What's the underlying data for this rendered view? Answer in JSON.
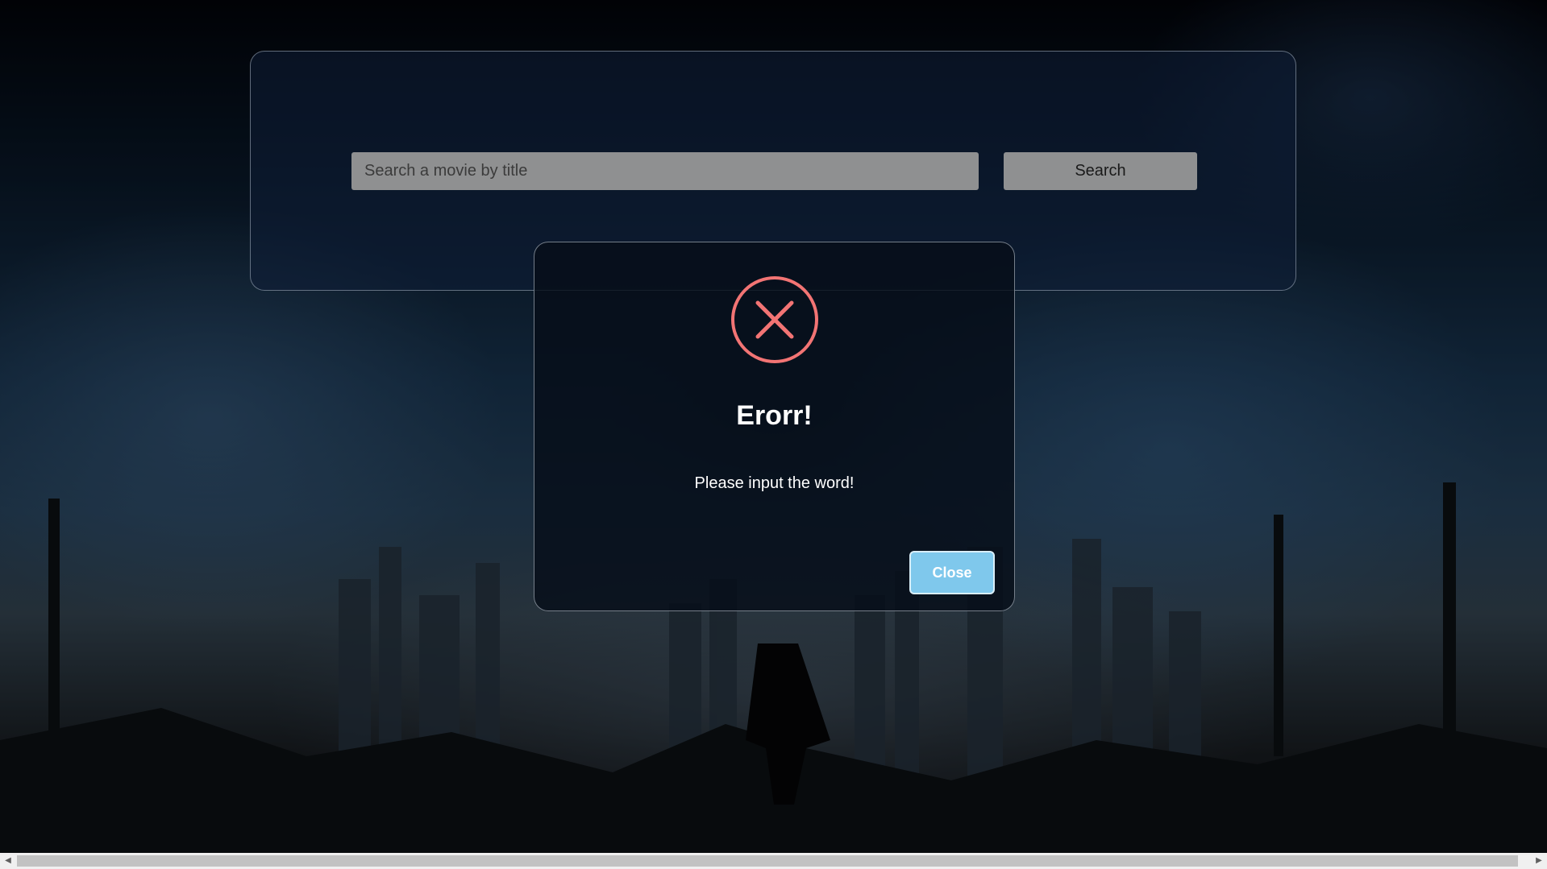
{
  "search": {
    "placeholder": "Search a movie by title",
    "value": "",
    "button_label": "Search"
  },
  "modal": {
    "icon": "error-x-circle-icon",
    "title": "Erorr!",
    "message": "Please input the word!",
    "close_label": "Close"
  },
  "scrollbar": {
    "left_arrow": "◀",
    "right_arrow": "▶"
  },
  "colors": {
    "error_icon": "#f27474",
    "close_button": "#7fc8ec",
    "input_background": "#8f9091"
  }
}
